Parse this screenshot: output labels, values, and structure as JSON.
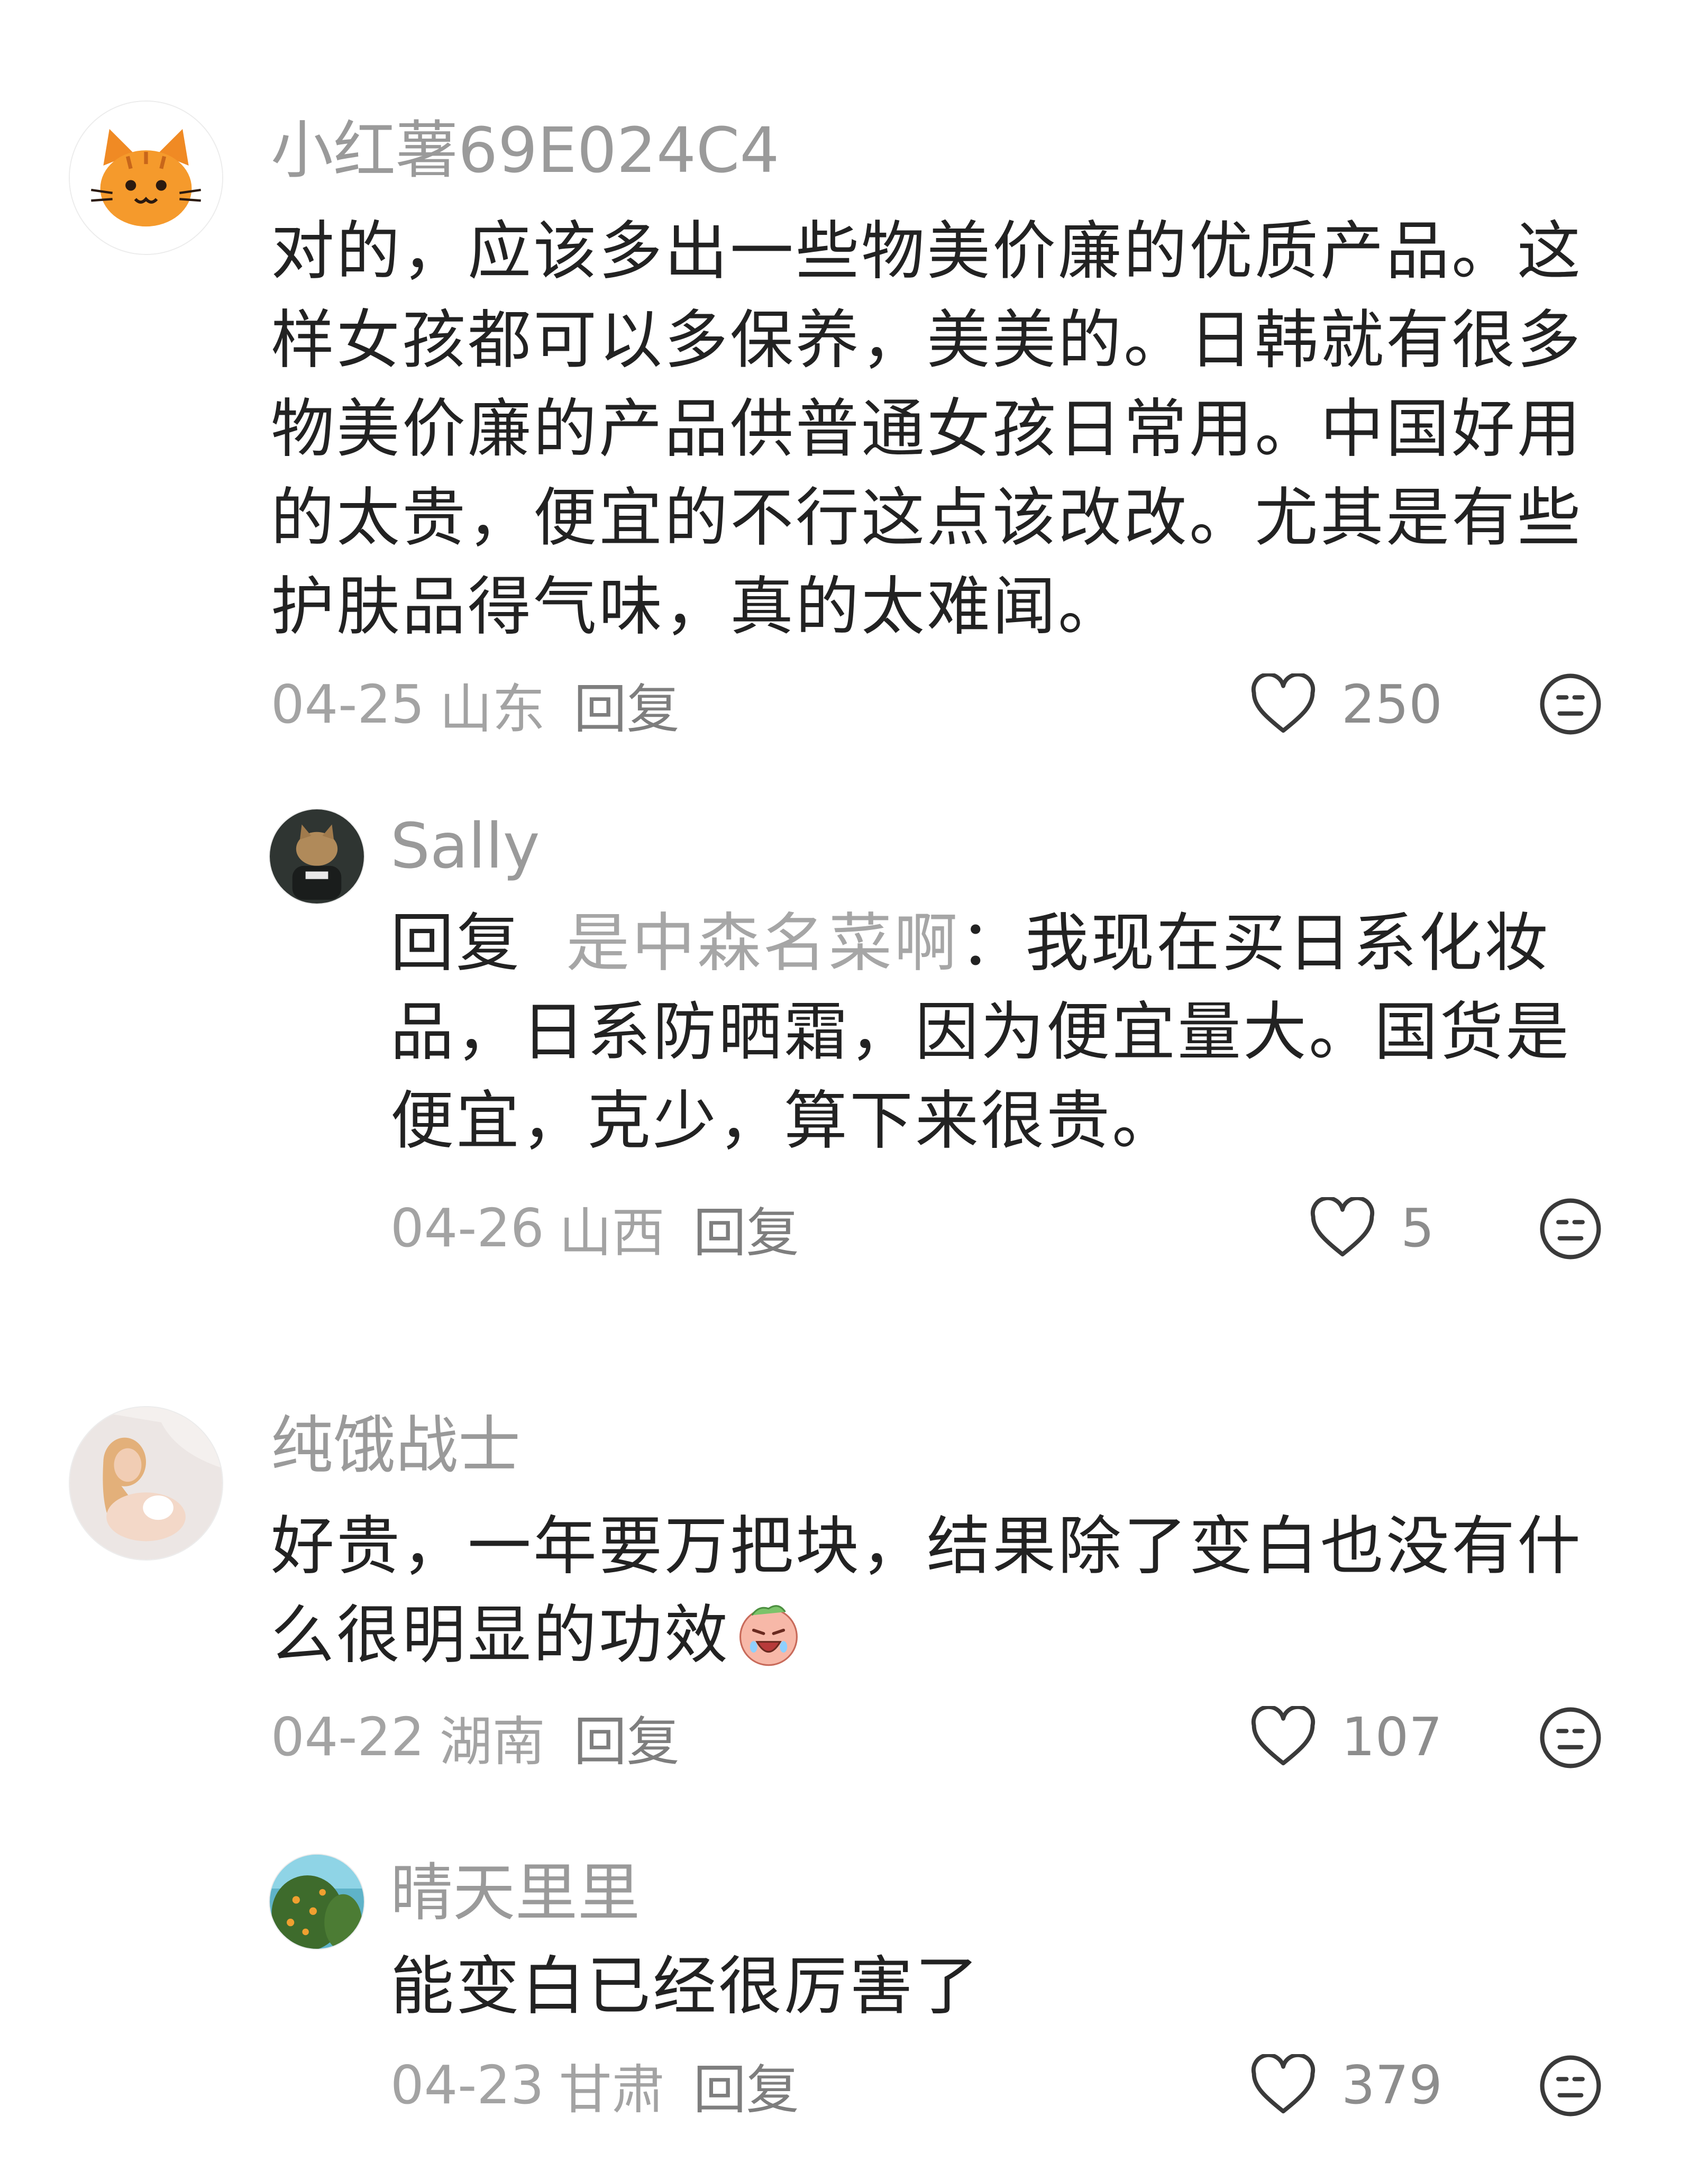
{
  "comments": [
    {
      "avatar": "orange-cat-avatar",
      "username": "小红薯69E024C4",
      "text": "对的，应该多出一些物美价廉的优质产品。这样女孩都可以多保养，美美的。日韩就有很多物美价廉的产品供普通女孩日常用。中国好用的太贵，便宜的不行这点该改改。尤其是有些护肤品得气味，真的太难闻。",
      "date": "04-25",
      "location": "山东",
      "reply_label": "回复",
      "likes": "250",
      "reply": {
        "avatar": "cat-photo-avatar",
        "username": "Sally",
        "prefix": "回复",
        "target": "是中森名菜啊",
        "separator": "：",
        "text": "我现在买日系化妆品，日系防晒霜，因为便宜量大。国货是便宜，克少，算下来很贵。",
        "date": "04-26",
        "location": "山西",
        "reply_label": "回复",
        "likes": "5"
      }
    },
    {
      "avatar": "blonde-girl-photo-avatar",
      "username": "纯饿战士",
      "text": "好贵，一年要万把块，结果除了变白也没有什么很明显的功效",
      "emoji": "crying-face-emoji",
      "date": "04-22",
      "location": "湖南",
      "reply_label": "回复",
      "likes": "107",
      "reply": {
        "avatar": "orange-tree-photo-avatar",
        "username": "晴天里里",
        "text": "能变白已经很厉害了",
        "date": "04-23",
        "location": "甘肃",
        "reply_label": "回复",
        "likes": "379"
      }
    }
  ]
}
